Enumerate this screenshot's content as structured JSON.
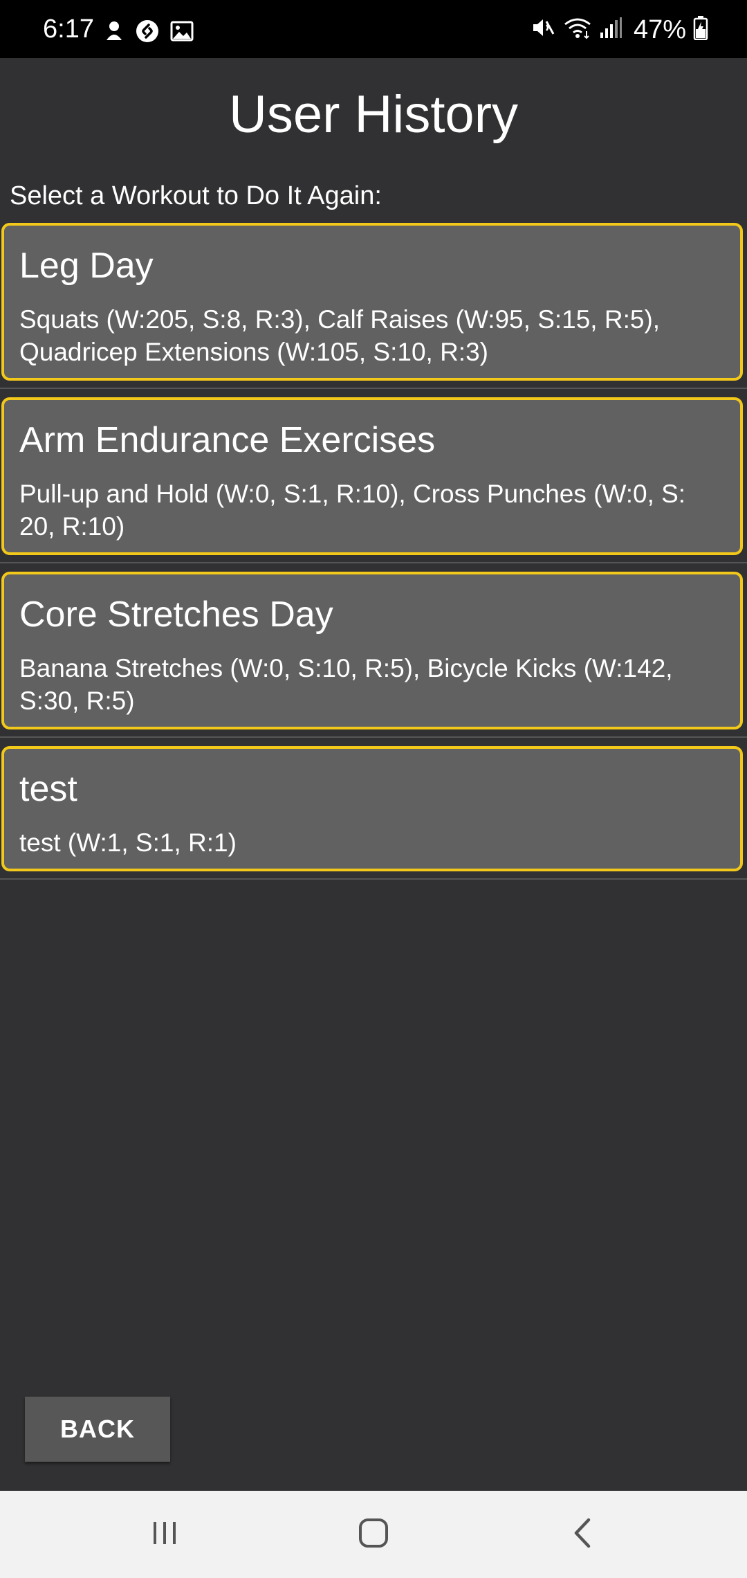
{
  "status_bar": {
    "time": "6:17",
    "battery": "47%",
    "left_icons": [
      "notification-icon",
      "shazam-icon",
      "gallery-icon"
    ],
    "right_icons": [
      "mute-icon",
      "wifi-icon",
      "signal-icon",
      "battery-icon"
    ]
  },
  "page": {
    "title": "User History",
    "subtitle": "Select a Workout to Do It Again:"
  },
  "workouts": [
    {
      "name": "Leg Day",
      "detail": "Squats (W:205, S:8, R:3), Calf Raises (W:95, S:15, R:5), Quadricep Extensions (W:105, S:10, R:3)"
    },
    {
      "name": "Arm Endurance Exercises",
      "detail": "Pull-up and Hold (W:0, S:1, R:10), Cross Punches (W:0, S: 20, R:10)"
    },
    {
      "name": "Core Stretches Day",
      "detail": "Banana Stretches (W:0, S:10, R:5), Bicycle Kicks (W:142, S:30, R:5)"
    },
    {
      "name": "test",
      "detail": "test (W:1, S:1, R:1)"
    }
  ],
  "back_button": {
    "label": "BACK"
  },
  "nav_bar": {
    "buttons": [
      "recent-apps-icon",
      "home-icon",
      "back-arrow-icon"
    ]
  },
  "colors": {
    "background": "#313133",
    "card_background": "#616161",
    "card_border": "#f2c81a",
    "status_bar": "#000000",
    "nav_bar": "#f2f2f2",
    "button": "#575757"
  }
}
